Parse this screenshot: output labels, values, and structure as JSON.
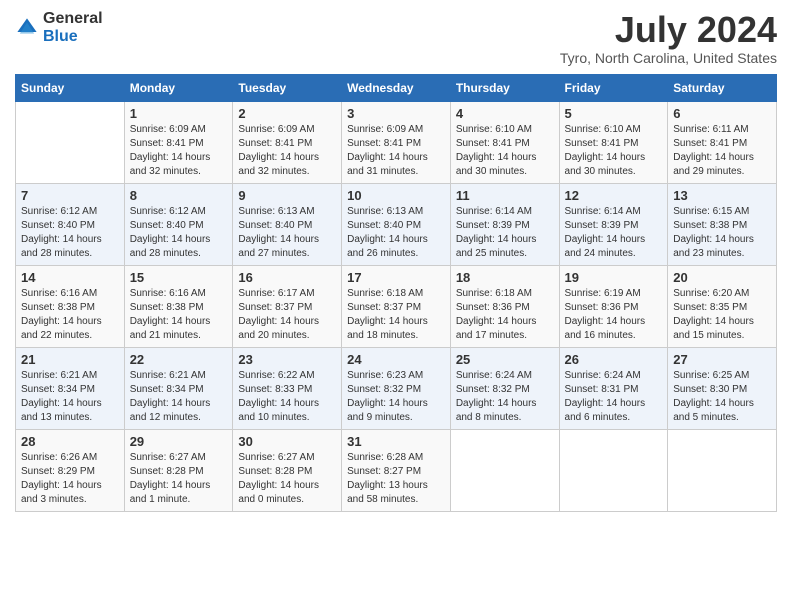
{
  "header": {
    "logo_general": "General",
    "logo_blue": "Blue",
    "month_title": "July 2024",
    "location": "Tyro, North Carolina, United States"
  },
  "calendar": {
    "days_of_week": [
      "Sunday",
      "Monday",
      "Tuesday",
      "Wednesday",
      "Thursday",
      "Friday",
      "Saturday"
    ],
    "weeks": [
      [
        {
          "day": "",
          "sunrise": "",
          "sunset": "",
          "daylight": ""
        },
        {
          "day": "1",
          "sunrise": "Sunrise: 6:09 AM",
          "sunset": "Sunset: 8:41 PM",
          "daylight": "Daylight: 14 hours and 32 minutes."
        },
        {
          "day": "2",
          "sunrise": "Sunrise: 6:09 AM",
          "sunset": "Sunset: 8:41 PM",
          "daylight": "Daylight: 14 hours and 32 minutes."
        },
        {
          "day": "3",
          "sunrise": "Sunrise: 6:09 AM",
          "sunset": "Sunset: 8:41 PM",
          "daylight": "Daylight: 14 hours and 31 minutes."
        },
        {
          "day": "4",
          "sunrise": "Sunrise: 6:10 AM",
          "sunset": "Sunset: 8:41 PM",
          "daylight": "Daylight: 14 hours and 30 minutes."
        },
        {
          "day": "5",
          "sunrise": "Sunrise: 6:10 AM",
          "sunset": "Sunset: 8:41 PM",
          "daylight": "Daylight: 14 hours and 30 minutes."
        },
        {
          "day": "6",
          "sunrise": "Sunrise: 6:11 AM",
          "sunset": "Sunset: 8:41 PM",
          "daylight": "Daylight: 14 hours and 29 minutes."
        }
      ],
      [
        {
          "day": "7",
          "sunrise": "Sunrise: 6:12 AM",
          "sunset": "Sunset: 8:40 PM",
          "daylight": "Daylight: 14 hours and 28 minutes."
        },
        {
          "day": "8",
          "sunrise": "Sunrise: 6:12 AM",
          "sunset": "Sunset: 8:40 PM",
          "daylight": "Daylight: 14 hours and 28 minutes."
        },
        {
          "day": "9",
          "sunrise": "Sunrise: 6:13 AM",
          "sunset": "Sunset: 8:40 PM",
          "daylight": "Daylight: 14 hours and 27 minutes."
        },
        {
          "day": "10",
          "sunrise": "Sunrise: 6:13 AM",
          "sunset": "Sunset: 8:40 PM",
          "daylight": "Daylight: 14 hours and 26 minutes."
        },
        {
          "day": "11",
          "sunrise": "Sunrise: 6:14 AM",
          "sunset": "Sunset: 8:39 PM",
          "daylight": "Daylight: 14 hours and 25 minutes."
        },
        {
          "day": "12",
          "sunrise": "Sunrise: 6:14 AM",
          "sunset": "Sunset: 8:39 PM",
          "daylight": "Daylight: 14 hours and 24 minutes."
        },
        {
          "day": "13",
          "sunrise": "Sunrise: 6:15 AM",
          "sunset": "Sunset: 8:38 PM",
          "daylight": "Daylight: 14 hours and 23 minutes."
        }
      ],
      [
        {
          "day": "14",
          "sunrise": "Sunrise: 6:16 AM",
          "sunset": "Sunset: 8:38 PM",
          "daylight": "Daylight: 14 hours and 22 minutes."
        },
        {
          "day": "15",
          "sunrise": "Sunrise: 6:16 AM",
          "sunset": "Sunset: 8:38 PM",
          "daylight": "Daylight: 14 hours and 21 minutes."
        },
        {
          "day": "16",
          "sunrise": "Sunrise: 6:17 AM",
          "sunset": "Sunset: 8:37 PM",
          "daylight": "Daylight: 14 hours and 20 minutes."
        },
        {
          "day": "17",
          "sunrise": "Sunrise: 6:18 AM",
          "sunset": "Sunset: 8:37 PM",
          "daylight": "Daylight: 14 hours and 18 minutes."
        },
        {
          "day": "18",
          "sunrise": "Sunrise: 6:18 AM",
          "sunset": "Sunset: 8:36 PM",
          "daylight": "Daylight: 14 hours and 17 minutes."
        },
        {
          "day": "19",
          "sunrise": "Sunrise: 6:19 AM",
          "sunset": "Sunset: 8:36 PM",
          "daylight": "Daylight: 14 hours and 16 minutes."
        },
        {
          "day": "20",
          "sunrise": "Sunrise: 6:20 AM",
          "sunset": "Sunset: 8:35 PM",
          "daylight": "Daylight: 14 hours and 15 minutes."
        }
      ],
      [
        {
          "day": "21",
          "sunrise": "Sunrise: 6:21 AM",
          "sunset": "Sunset: 8:34 PM",
          "daylight": "Daylight: 14 hours and 13 minutes."
        },
        {
          "day": "22",
          "sunrise": "Sunrise: 6:21 AM",
          "sunset": "Sunset: 8:34 PM",
          "daylight": "Daylight: 14 hours and 12 minutes."
        },
        {
          "day": "23",
          "sunrise": "Sunrise: 6:22 AM",
          "sunset": "Sunset: 8:33 PM",
          "daylight": "Daylight: 14 hours and 10 minutes."
        },
        {
          "day": "24",
          "sunrise": "Sunrise: 6:23 AM",
          "sunset": "Sunset: 8:32 PM",
          "daylight": "Daylight: 14 hours and 9 minutes."
        },
        {
          "day": "25",
          "sunrise": "Sunrise: 6:24 AM",
          "sunset": "Sunset: 8:32 PM",
          "daylight": "Daylight: 14 hours and 8 minutes."
        },
        {
          "day": "26",
          "sunrise": "Sunrise: 6:24 AM",
          "sunset": "Sunset: 8:31 PM",
          "daylight": "Daylight: 14 hours and 6 minutes."
        },
        {
          "day": "27",
          "sunrise": "Sunrise: 6:25 AM",
          "sunset": "Sunset: 8:30 PM",
          "daylight": "Daylight: 14 hours and 5 minutes."
        }
      ],
      [
        {
          "day": "28",
          "sunrise": "Sunrise: 6:26 AM",
          "sunset": "Sunset: 8:29 PM",
          "daylight": "Daylight: 14 hours and 3 minutes."
        },
        {
          "day": "29",
          "sunrise": "Sunrise: 6:27 AM",
          "sunset": "Sunset: 8:28 PM",
          "daylight": "Daylight: 14 hours and 1 minute."
        },
        {
          "day": "30",
          "sunrise": "Sunrise: 6:27 AM",
          "sunset": "Sunset: 8:28 PM",
          "daylight": "Daylight: 14 hours and 0 minutes."
        },
        {
          "day": "31",
          "sunrise": "Sunrise: 6:28 AM",
          "sunset": "Sunset: 8:27 PM",
          "daylight": "Daylight: 13 hours and 58 minutes."
        },
        {
          "day": "",
          "sunrise": "",
          "sunset": "",
          "daylight": ""
        },
        {
          "day": "",
          "sunrise": "",
          "sunset": "",
          "daylight": ""
        },
        {
          "day": "",
          "sunrise": "",
          "sunset": "",
          "daylight": ""
        }
      ]
    ]
  }
}
